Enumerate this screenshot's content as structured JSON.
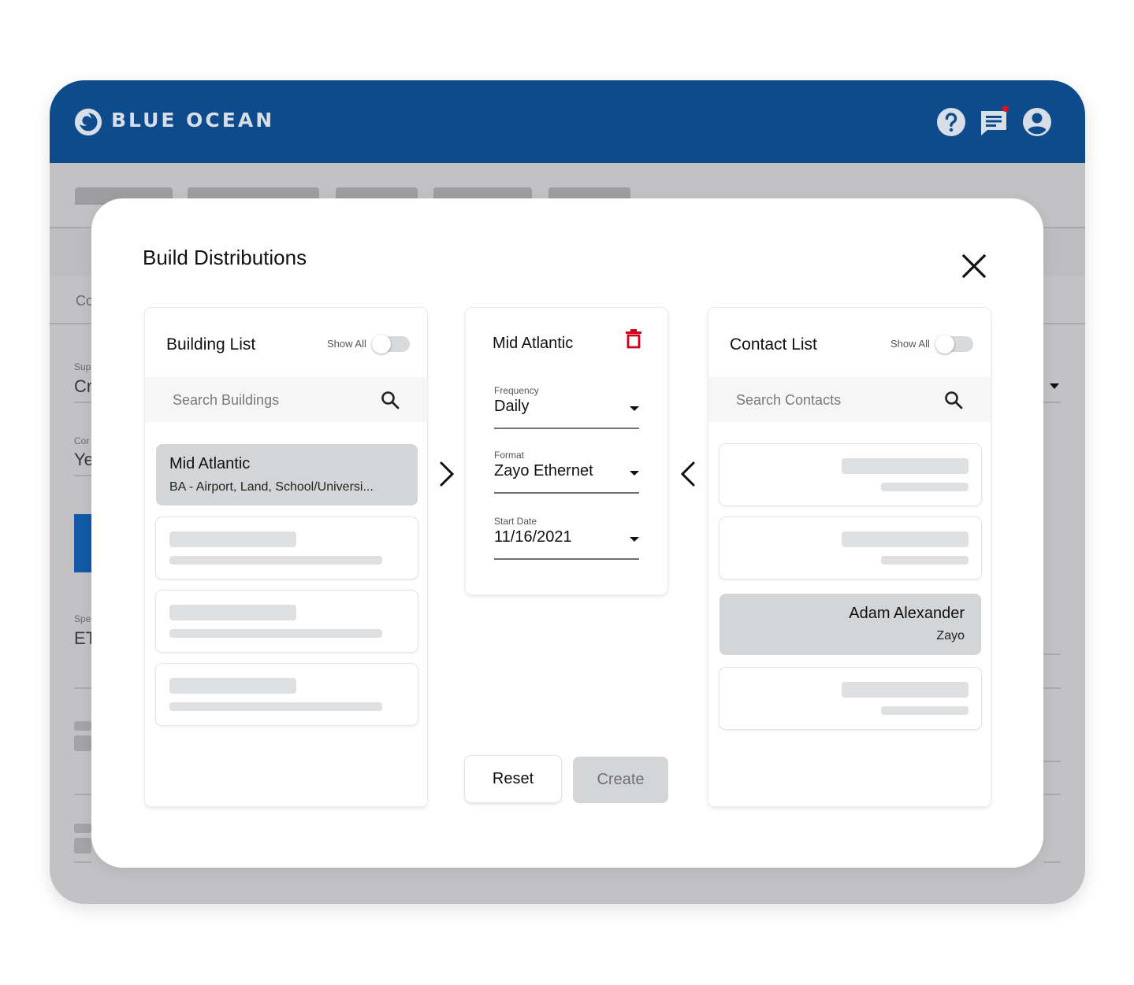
{
  "app": {
    "brand": "BLUE OCEAN",
    "colors": {
      "header": "#0e4b8c",
      "danger": "#d0021b",
      "notification_dot": "#e0101e"
    },
    "header_icons": [
      "help-icon",
      "chat-icon",
      "account-icon"
    ]
  },
  "background_page": {
    "fragments": [
      "Co",
      "Sup",
      "Cr",
      "Cor",
      "Ye",
      "Spe",
      "ET"
    ]
  },
  "modal": {
    "title": "Build Distributions",
    "building_list": {
      "title": "Building List",
      "show_all_label": "Show All",
      "show_all_on": false,
      "search_placeholder": "Search Buildings",
      "items": [
        {
          "title": "Mid Atlantic",
          "subtitle": "BA - Airport, Land, School/Universi...",
          "selected": true
        }
      ]
    },
    "distribution": {
      "name": "Mid Atlantic",
      "frequency_label": "Frequency",
      "frequency_value": "Daily",
      "format_label": "Format",
      "format_value": "Zayo Ethernet",
      "start_date_label": "Start Date",
      "start_date_value": "11/16/2021"
    },
    "contact_list": {
      "title": "Contact List",
      "show_all_label": "Show All",
      "show_all_on": false,
      "search_placeholder": "Search Contacts",
      "items": [
        {
          "name": "Adam Alexander",
          "company": "Zayo",
          "selected": true
        }
      ]
    },
    "buttons": {
      "reset": "Reset",
      "create": "Create",
      "create_enabled": false
    }
  }
}
